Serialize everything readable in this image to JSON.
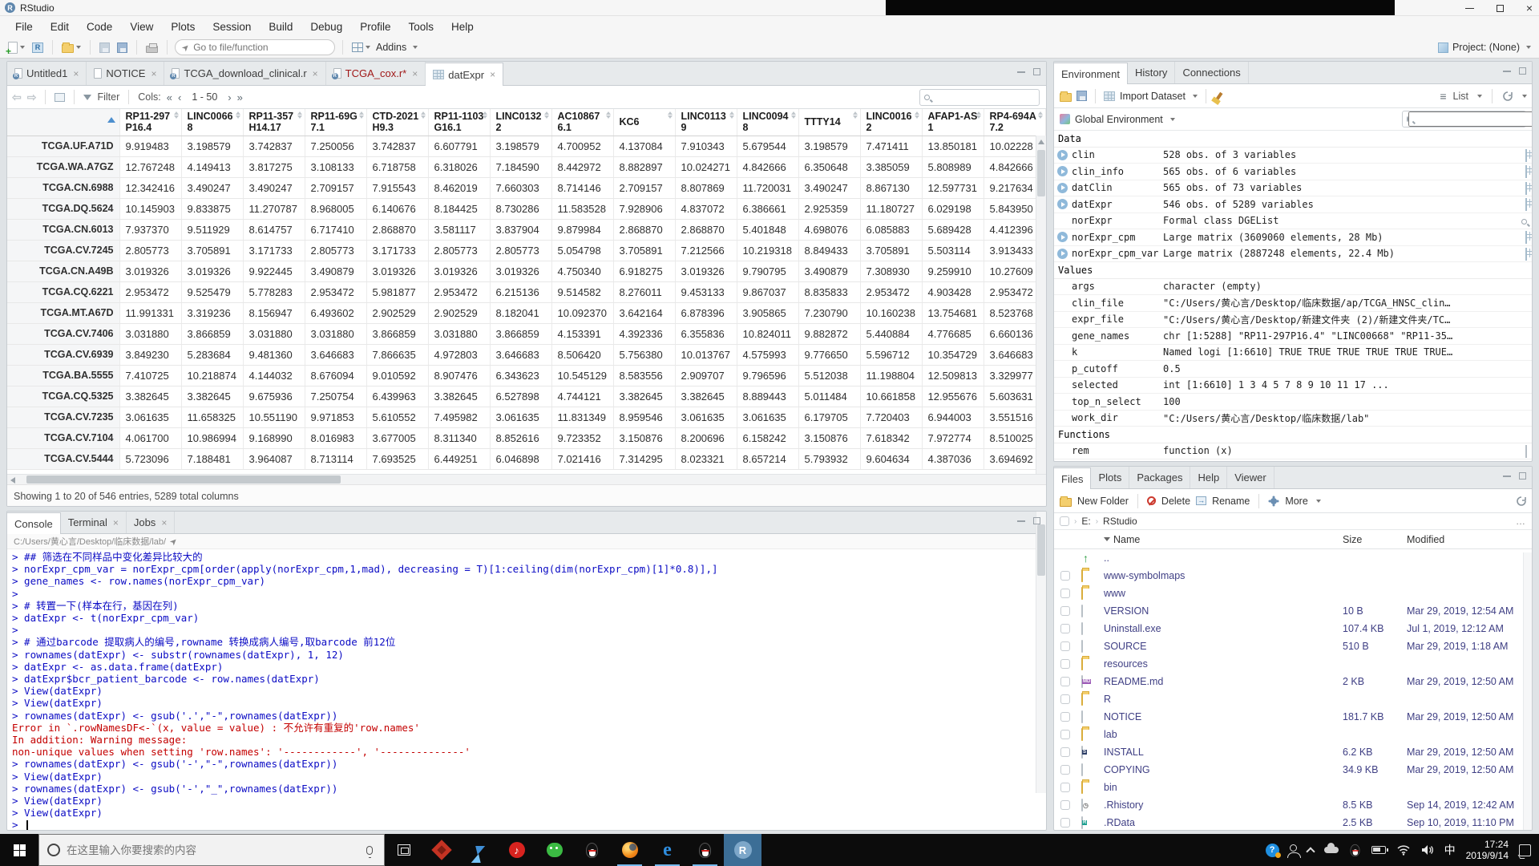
{
  "window": {
    "title": "RStudio"
  },
  "menu": [
    "File",
    "Edit",
    "Code",
    "View",
    "Plots",
    "Session",
    "Build",
    "Debug",
    "Profile",
    "Tools",
    "Help"
  ],
  "toolbar": {
    "goto_placeholder": "Go to file/function",
    "addins_label": "Addins",
    "project_label": "Project: (None)"
  },
  "editor": {
    "tabs": [
      {
        "label": "Untitled1",
        "icon": "r-doc",
        "active": false,
        "modified": false
      },
      {
        "label": "NOTICE",
        "icon": "doc",
        "active": false,
        "modified": false
      },
      {
        "label": "TCGA_download_clinical.r",
        "icon": "r-doc",
        "active": false,
        "modified": false
      },
      {
        "label": "TCGA_cox.r*",
        "icon": "r-doc",
        "active": false,
        "modified": true
      },
      {
        "label": "datExpr",
        "icon": "grid",
        "active": true,
        "modified": false
      }
    ]
  },
  "data_viewer": {
    "filter_label": "Filter",
    "cols_label": "Cols:",
    "cols_range": "1 - 50",
    "search_placeholder": "",
    "status": "Showing 1 to 20 of 546 entries, 5289 total columns",
    "columns": [
      "RP11-297P16.4",
      "LINC00668",
      "RP11-357H14.17",
      "RP11-69G7.1",
      "CTD-2021H9.3",
      "RP11-1103G16.1",
      "LINC01322",
      "AC108676.1",
      "KC6",
      "LINC01139",
      "LINC00948",
      "TTTY14",
      "LINC00162",
      "AFAP1-AS1",
      "RP4-694A7.2"
    ],
    "rows": [
      {
        "name": "TCGA.UF.A71D",
        "values": [
          "9.919483",
          "3.198579",
          "3.742837",
          "7.250056",
          "3.742837",
          "6.607791",
          "3.198579",
          "4.700952",
          "4.137084",
          "7.910343",
          "5.679544",
          "3.198579",
          "7.471411",
          "13.850181",
          "10.02228"
        ]
      },
      {
        "name": "TCGA.WA.A7GZ",
        "values": [
          "12.767248",
          "4.149413",
          "3.817275",
          "3.108133",
          "6.718758",
          "6.318026",
          "7.184590",
          "8.442972",
          "8.882897",
          "10.024271",
          "4.842666",
          "6.350648",
          "3.385059",
          "5.808989",
          "4.842666"
        ]
      },
      {
        "name": "TCGA.CN.6988",
        "values": [
          "12.342416",
          "3.490247",
          "3.490247",
          "2.709157",
          "7.915543",
          "8.462019",
          "7.660303",
          "8.714146",
          "2.709157",
          "8.807869",
          "11.720031",
          "3.490247",
          "8.867130",
          "12.597731",
          "9.217634"
        ]
      },
      {
        "name": "TCGA.DQ.5624",
        "values": [
          "10.145903",
          "9.833875",
          "11.270787",
          "8.968005",
          "6.140676",
          "8.184425",
          "8.730286",
          "11.583528",
          "7.928906",
          "4.837072",
          "6.386661",
          "2.925359",
          "11.180727",
          "6.029198",
          "5.843950"
        ]
      },
      {
        "name": "TCGA.CN.6013",
        "values": [
          "7.937370",
          "9.511929",
          "8.614757",
          "6.717410",
          "2.868870",
          "3.581117",
          "3.837904",
          "9.879984",
          "2.868870",
          "2.868870",
          "5.401848",
          "4.698076",
          "6.085883",
          "5.689428",
          "4.412396"
        ]
      },
      {
        "name": "TCGA.CV.7245",
        "values": [
          "2.805773",
          "3.705891",
          "3.171733",
          "2.805773",
          "3.171733",
          "2.805773",
          "2.805773",
          "5.054798",
          "3.705891",
          "7.212566",
          "10.219318",
          "8.849433",
          "3.705891",
          "5.503114",
          "3.913433"
        ]
      },
      {
        "name": "TCGA.CN.A49B",
        "values": [
          "3.019326",
          "3.019326",
          "9.922445",
          "3.490879",
          "3.019326",
          "3.019326",
          "3.019326",
          "4.750340",
          "6.918275",
          "3.019326",
          "9.790795",
          "3.490879",
          "7.308930",
          "9.259910",
          "10.27609"
        ]
      },
      {
        "name": "TCGA.CQ.6221",
        "values": [
          "2.953472",
          "9.525479",
          "5.778283",
          "2.953472",
          "5.981877",
          "2.953472",
          "6.215136",
          "9.514582",
          "8.276011",
          "9.453133",
          "9.867037",
          "8.835833",
          "2.953472",
          "4.903428",
          "2.953472"
        ]
      },
      {
        "name": "TCGA.MT.A67D",
        "values": [
          "11.991331",
          "3.319236",
          "8.156947",
          "6.493602",
          "2.902529",
          "2.902529",
          "8.182041",
          "10.092370",
          "3.642164",
          "6.878396",
          "3.905865",
          "7.230790",
          "10.160238",
          "13.754681",
          "8.523768"
        ]
      },
      {
        "name": "TCGA.CV.7406",
        "values": [
          "3.031880",
          "3.866859",
          "3.031880",
          "3.031880",
          "3.866859",
          "3.031880",
          "3.866859",
          "4.153391",
          "4.392336",
          "6.355836",
          "10.824011",
          "9.882872",
          "5.440884",
          "4.776685",
          "6.660136"
        ]
      },
      {
        "name": "TCGA.CV.6939",
        "values": [
          "3.849230",
          "5.283684",
          "9.481360",
          "3.646683",
          "7.866635",
          "4.972803",
          "3.646683",
          "8.506420",
          "5.756380",
          "10.013767",
          "4.575993",
          "9.776650",
          "5.596712",
          "10.354729",
          "3.646683"
        ]
      },
      {
        "name": "TCGA.BA.5555",
        "values": [
          "7.410725",
          "10.218874",
          "4.144032",
          "8.676094",
          "9.010592",
          "8.907476",
          "6.343623",
          "10.545129",
          "8.583556",
          "2.909707",
          "9.796596",
          "5.512038",
          "11.198804",
          "12.509813",
          "3.329977"
        ]
      },
      {
        "name": "TCGA.CQ.5325",
        "values": [
          "3.382645",
          "3.382645",
          "9.675936",
          "7.250754",
          "6.439963",
          "3.382645",
          "6.527898",
          "4.744121",
          "3.382645",
          "3.382645",
          "8.889443",
          "5.011484",
          "10.661858",
          "12.955676",
          "5.603631"
        ]
      },
      {
        "name": "TCGA.CV.7235",
        "values": [
          "3.061635",
          "11.658325",
          "10.551190",
          "9.971853",
          "5.610552",
          "7.495982",
          "3.061635",
          "11.831349",
          "8.959546",
          "3.061635",
          "3.061635",
          "6.179705",
          "7.720403",
          "6.944003",
          "3.551516"
        ]
      },
      {
        "name": "TCGA.CV.7104",
        "values": [
          "4.061700",
          "10.986994",
          "9.168990",
          "8.016983",
          "3.677005",
          "8.311340",
          "8.852616",
          "9.723352",
          "3.150876",
          "8.200696",
          "6.158242",
          "3.150876",
          "7.618342",
          "7.972774",
          "8.510025"
        ]
      },
      {
        "name": "TCGA.CV.5444",
        "values": [
          "5.723096",
          "7.188481",
          "3.964087",
          "8.713114",
          "7.693525",
          "6.449251",
          "6.046898",
          "7.021416",
          "7.314295",
          "8.023321",
          "8.657214",
          "5.793932",
          "9.604634",
          "4.387036",
          "3.694692"
        ]
      }
    ]
  },
  "console": {
    "tabs": [
      {
        "label": "Console",
        "active": true,
        "closable": false
      },
      {
        "label": "Terminal",
        "active": false,
        "closable": true
      },
      {
        "label": "Jobs",
        "active": false,
        "closable": true
      }
    ],
    "path": "C:/Users/黄心言/Desktop/临床数据/lab/",
    "lines": [
      {
        "type": "input",
        "text": "## 筛选在不同样品中变化差异比较大的"
      },
      {
        "type": "input",
        "text": "norExpr_cpm_var = norExpr_cpm[order(apply(norExpr_cpm,1,mad), decreasing = T)[1:ceiling(dim(norExpr_cpm)[1]*0.8)],]"
      },
      {
        "type": "input",
        "text": "gene_names <- row.names(norExpr_cpm_var)"
      },
      {
        "type": "input",
        "text": ""
      },
      {
        "type": "input",
        "text": "# 转置一下(样本在行，基因在列)"
      },
      {
        "type": "input",
        "text": "datExpr <- t(norExpr_cpm_var)"
      },
      {
        "type": "input",
        "text": ""
      },
      {
        "type": "input",
        "text": "# 通过barcode 提取病人的编号,rowname 转换成病人编号,取barcode 前12位"
      },
      {
        "type": "input",
        "text": "rownames(datExpr) <- substr(rownames(datExpr), 1, 12)"
      },
      {
        "type": "input",
        "text": "datExpr <- as.data.frame(datExpr)"
      },
      {
        "type": "input",
        "text": "datExpr$bcr_patient_barcode <- row.names(datExpr)"
      },
      {
        "type": "input",
        "text": "View(datExpr)"
      },
      {
        "type": "input",
        "text": "View(datExpr)"
      },
      {
        "type": "input",
        "text": "rownames(datExpr) <- gsub('.',\"-\",rownames(datExpr))"
      },
      {
        "type": "error",
        "text": "Error in `.rowNamesDF<-`(x, value = value) : 不允许有重复的'row.names'"
      },
      {
        "type": "error",
        "text": "In addition: Warning message:"
      },
      {
        "type": "error",
        "text": "non-unique values when setting 'row.names': '------------', '--------------'"
      },
      {
        "type": "input",
        "text": "rownames(datExpr) <- gsub('-',\"-\",rownames(datExpr))"
      },
      {
        "type": "input",
        "text": "View(datExpr)"
      },
      {
        "type": "input",
        "text": "rownames(datExpr) <- gsub('-',\"_\",rownames(datExpr))"
      },
      {
        "type": "input",
        "text": "View(datExpr)"
      },
      {
        "type": "input",
        "text": "View(datExpr)"
      },
      {
        "type": "prompt",
        "text": ""
      }
    ]
  },
  "environment": {
    "tabs": [
      {
        "label": "Environment",
        "active": true
      },
      {
        "label": "History",
        "active": false
      },
      {
        "label": "Connections",
        "active": false
      }
    ],
    "toolbar": {
      "import_label": "Import Dataset",
      "list_label": "List"
    },
    "scope_label": "Global Environment",
    "search_placeholder": "",
    "sections": [
      {
        "title": "Data",
        "items": [
          {
            "name": "clin",
            "value": "528 obs. of 3 variables",
            "expand": true,
            "action": "grid"
          },
          {
            "name": "clin_info",
            "value": "565 obs. of 6 variables",
            "expand": true,
            "action": "grid"
          },
          {
            "name": "datClin",
            "value": "565 obs. of 73 variables",
            "expand": true,
            "action": "grid"
          },
          {
            "name": "datExpr",
            "value": "546 obs. of 5289 variables",
            "expand": true,
            "action": "grid"
          },
          {
            "name": "norExpr",
            "value": "Formal class DGEList",
            "expand": false,
            "action": "magnifier"
          },
          {
            "name": "norExpr_cpm",
            "value": "Large matrix (3609060 elements, 28 Mb)",
            "expand": true,
            "action": "grid"
          },
          {
            "name": "norExpr_cpm_var",
            "value": "Large matrix (2887248 elements, 22.4 Mb)",
            "expand": true,
            "action": "grid"
          }
        ]
      },
      {
        "title": "Values",
        "items": [
          {
            "name": "args",
            "value": "character (empty)",
            "expand": false,
            "action": null
          },
          {
            "name": "clin_file",
            "value": "\"C:/Users/黄心言/Desktop/临床数据/ap/TCGA_HNSC_clin…",
            "expand": false,
            "action": null
          },
          {
            "name": "expr_file",
            "value": "\"C:/Users/黄心言/Desktop/新建文件夹 (2)/新建文件夹/TC…",
            "expand": false,
            "action": null
          },
          {
            "name": "gene_names",
            "value": "chr [1:5288] \"RP11-297P16.4\" \"LINC00668\" \"RP11-35…",
            "expand": false,
            "action": null
          },
          {
            "name": "k",
            "value": "Named logi [1:6610] TRUE TRUE TRUE TRUE TRUE TRUE…",
            "expand": false,
            "action": null
          },
          {
            "name": "p_cutoff",
            "value": "0.5",
            "expand": false,
            "action": null
          },
          {
            "name": "selected",
            "value": "int [1:6610] 1 3 4 5 7 8 9 10 11 17 ...",
            "expand": false,
            "action": null
          },
          {
            "name": "top_n_select",
            "value": "100",
            "expand": false,
            "action": null
          },
          {
            "name": "work_dir",
            "value": "\"C:/Users/黄心言/Desktop/临床数据/lab\"",
            "expand": false,
            "action": null
          }
        ]
      },
      {
        "title": "Functions",
        "items": [
          {
            "name": "rem",
            "value": "function (x)",
            "expand": false,
            "action": "doc"
          }
        ]
      }
    ]
  },
  "files": {
    "tabs": [
      {
        "label": "Files",
        "active": true
      },
      {
        "label": "Plots",
        "active": false
      },
      {
        "label": "Packages",
        "active": false
      },
      {
        "label": "Help",
        "active": false
      },
      {
        "label": "Viewer",
        "active": false
      }
    ],
    "toolbar": {
      "new_folder": "New Folder",
      "delete": "Delete",
      "rename": "Rename",
      "more": "More"
    },
    "breadcrumb": [
      "E:",
      "RStudio"
    ],
    "headers": {
      "name": "Name",
      "size": "Size",
      "modified": "Modified"
    },
    "rows": [
      {
        "icon": "up",
        "name": "..",
        "size": "",
        "modified": ""
      },
      {
        "icon": "folder",
        "name": "www-symbolmaps",
        "size": "",
        "modified": ""
      },
      {
        "icon": "folder",
        "name": "www",
        "size": "",
        "modified": ""
      },
      {
        "icon": "file",
        "name": "VERSION",
        "size": "10 B",
        "modified": "Mar 29, 2019, 12:54 AM"
      },
      {
        "icon": "file",
        "name": "Uninstall.exe",
        "size": "107.4 KB",
        "modified": "Jul 1, 2019, 12:12 AM"
      },
      {
        "icon": "file",
        "name": "SOURCE",
        "size": "510 B",
        "modified": "Mar 29, 2019, 1:18 AM"
      },
      {
        "icon": "folder",
        "name": "resources",
        "size": "",
        "modified": ""
      },
      {
        "icon": "md",
        "name": "README.md",
        "size": "2 KB",
        "modified": "Mar 29, 2019, 12:50 AM"
      },
      {
        "icon": "folder",
        "name": "R",
        "size": "",
        "modified": ""
      },
      {
        "icon": "file",
        "name": "NOTICE",
        "size": "181.7 KB",
        "modified": "Mar 29, 2019, 12:50 AM"
      },
      {
        "icon": "folder",
        "name": "lab",
        "size": "",
        "modified": ""
      },
      {
        "icon": "install",
        "name": "INSTALL",
        "size": "6.2 KB",
        "modified": "Mar 29, 2019, 12:50 AM"
      },
      {
        "icon": "file",
        "name": "COPYING",
        "size": "34.9 KB",
        "modified": "Mar 29, 2019, 12:50 AM"
      },
      {
        "icon": "folder",
        "name": "bin",
        "size": "",
        "modified": ""
      },
      {
        "icon": "rhistory",
        "name": ".Rhistory",
        "size": "8.5 KB",
        "modified": "Sep 14, 2019, 12:42 AM"
      },
      {
        "icon": "rdata",
        "name": ".RData",
        "size": "2.5 KB",
        "modified": "Sep 10, 2019, 11:10 PM"
      }
    ]
  },
  "taskbar": {
    "search_placeholder": "在这里输入你要搜索的内容",
    "apps": [
      {
        "id": "task-view",
        "indicator": false,
        "active": false
      },
      {
        "id": "omen",
        "indicator": false,
        "active": false
      },
      {
        "id": "thunder",
        "indicator": false,
        "active": false
      },
      {
        "id": "netease",
        "indicator": false,
        "active": false
      },
      {
        "id": "wechat",
        "indicator": false,
        "active": false
      },
      {
        "id": "qq",
        "indicator": false,
        "active": false
      },
      {
        "id": "firefox",
        "indicator": true,
        "active": false
      },
      {
        "id": "edge",
        "indicator": true,
        "active": false
      },
      {
        "id": "qq2",
        "indicator": true,
        "active": false
      },
      {
        "id": "rstudio",
        "indicator": false,
        "active": true
      }
    ],
    "ime": "中",
    "time": "17:24",
    "date": "2019/9/14"
  }
}
